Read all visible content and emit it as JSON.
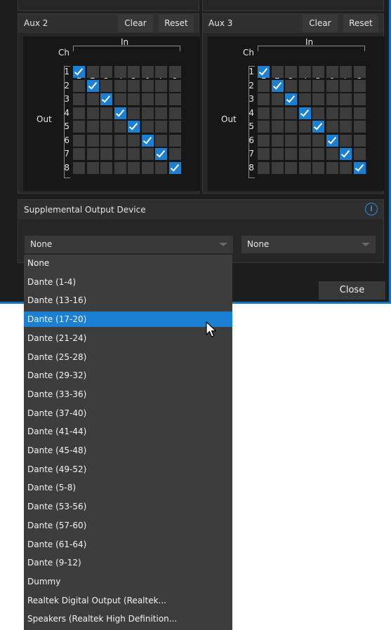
{
  "aux2": {
    "title": "Aux 2",
    "clear_label": "Clear",
    "reset_label": "Reset",
    "in_label": "In",
    "ch_label": "Ch",
    "out_label": "Out",
    "inputs": [
      "1",
      "2",
      "3",
      "4",
      "5",
      "6",
      "7",
      "8"
    ],
    "outputs": [
      "1",
      "2",
      "3",
      "4",
      "5",
      "6",
      "7",
      "8"
    ]
  },
  "aux3": {
    "title": "Aux 3",
    "clear_label": "Clear",
    "reset_label": "Reset",
    "in_label": "In",
    "ch_label": "Ch",
    "out_label": "Out",
    "inputs": [
      "1",
      "2",
      "3",
      "4",
      "5",
      "6",
      "7",
      "8"
    ],
    "outputs": [
      "1",
      "2",
      "3",
      "4",
      "5",
      "6",
      "7",
      "8"
    ]
  },
  "supplemental": {
    "title": "Supplemental Output Device",
    "info_icon": "i",
    "device1_value": "None",
    "device2_value": "None"
  },
  "footer": {
    "close_label": "Close"
  },
  "dropdown": {
    "selected_index": 4,
    "options": [
      "None",
      "Dante (1-4)",
      "Dante (13-16)",
      "Dante (17-20)",
      "Dante (21-24)",
      "Dante (25-28)",
      "Dante (29-32)",
      "Dante (33-36)",
      "Dante (37-40)",
      "Dante (41-44)",
      "Dante (45-48)",
      "Dante (49-52)",
      "Dante (5-8)",
      "Dante (53-56)",
      "Dante (57-60)",
      "Dante (61-64)",
      "Dante (9-12)",
      "Dummy",
      "Realtek Digital Output (Realtek...",
      "Speakers (Realtek High Definition..."
    ]
  },
  "colors": {
    "accent": "#1b7fd2",
    "dialog_bg": "#1d1d1d",
    "panel_bg": "#262626",
    "dropdown_bg": "#3d3d3d"
  }
}
